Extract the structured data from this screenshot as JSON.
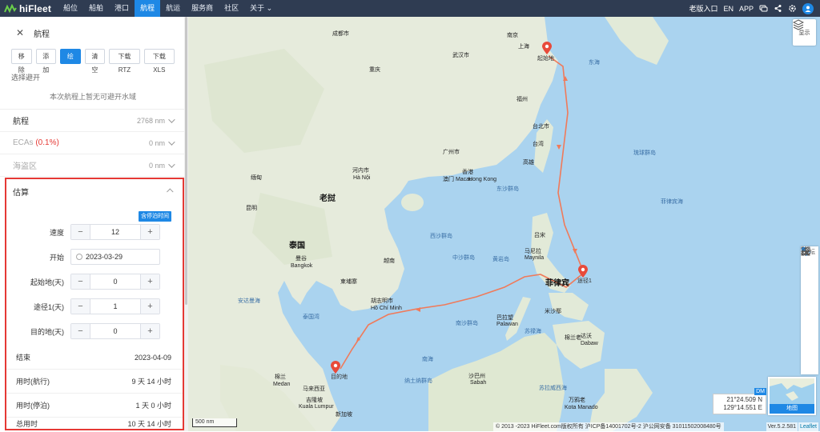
{
  "brand": {
    "name": "hiFleet"
  },
  "nav": {
    "items": [
      {
        "label": "船位",
        "active": false
      },
      {
        "label": "船舶",
        "active": false
      },
      {
        "label": "港口",
        "active": false
      },
      {
        "label": "航程",
        "active": true
      },
      {
        "label": "航运",
        "active": false
      },
      {
        "label": "服务商",
        "active": false
      },
      {
        "label": "社区",
        "active": false
      },
      {
        "label": "关于",
        "active": false
      }
    ],
    "right": {
      "old_version": "老版入口",
      "lang": "EN",
      "app": "APP"
    }
  },
  "panel": {
    "title": "航程",
    "buttons": [
      {
        "label": "移除",
        "primary": false
      },
      {
        "label": "添加",
        "primary": false
      },
      {
        "label": "绘制",
        "primary": true
      },
      {
        "label": "清空",
        "primary": false
      },
      {
        "label": "下载RTZ",
        "primary": false
      },
      {
        "label": "下载XLS",
        "primary": false
      }
    ],
    "avoid_title": "选择避开",
    "avoid_note": "本次航程上暂无可避开水域",
    "metrics": [
      {
        "label": "航程",
        "value": "2768 nm",
        "muted": false
      },
      {
        "label": "ECAs",
        "extra": "(0.1%)",
        "value": "0 nm",
        "muted": true
      },
      {
        "label": "海盗区",
        "value": "0 nm",
        "muted": true
      }
    ],
    "estimate": {
      "title": "估算",
      "stop_time_button": "含停泊时间",
      "speed": {
        "label": "速度",
        "value": "12"
      },
      "start": {
        "label": "开始",
        "value": "2023-03-29"
      },
      "origin_days": {
        "label": "起始地(天)",
        "value": "0"
      },
      "waypoint_days": {
        "label": "途径1(天)",
        "value": "1"
      },
      "dest_days": {
        "label": "目的地(天)",
        "value": "0"
      },
      "results": [
        {
          "label": "结束",
          "value": "2023-04-09"
        },
        {
          "label": "用时(航行)",
          "value": "9 天 14 小时"
        },
        {
          "label": "用时(停泊)",
          "value": "1 天 0 小时"
        },
        {
          "label": "总用时",
          "value": "10 天 14 小时"
        }
      ]
    }
  },
  "map": {
    "layers_label": "显示",
    "toolbox_label": "论坛",
    "coord_lat": "21°24.509 N",
    "coord_lon": "129°14.551 E",
    "coord_tag": "DM",
    "minimap_label": "地图",
    "scale": "500 nm",
    "attribution": "© 2013 -2023 HiFleet.com版权所有 沪ICP备14001702号-2 沪公网安备 31011502008480号",
    "version": "Ver.5.2.581",
    "leaflet": "Leaflet",
    "markers": {
      "origin": "起始地",
      "waypoint": "途径1",
      "destination": "目的地"
    },
    "labels": {
      "chengdu": "成都市",
      "chongqing": "重庆",
      "wuhan": "武汉市",
      "shanghai": "上海",
      "nanjing": "南京",
      "hangzhou": "杭州",
      "donghai": "东海",
      "fuzhou": "福州",
      "taibei": "台北市",
      "taiwan": "台湾",
      "gaoxiong": "高雄",
      "guangzhou": "广州市",
      "xianggang": "香港",
      "hongkong": "Hong Kong",
      "aomen": "澳门 Macau",
      "dongsha": "东沙群岛",
      "hanoi_cn": "河内市",
      "hanoi": "Hà Nội",
      "laos": "老挝",
      "burma": "缅甸",
      "thailand": "泰国",
      "bangkok_cn": "曼谷",
      "bangkok": "Bangkok",
      "cambodia": "柬埔寨",
      "vietnam": "越南",
      "hcm_cn": "胡志明市",
      "hcm": "Hồ Chí Minh",
      "xisha": "西沙群岛",
      "zhongsha": "中沙群岛",
      "huangyan": "黄岩岛",
      "nansha": "南沙群岛",
      "manila_cn": "马尼拉",
      "manila": "Maynila",
      "philippines": "菲律宾",
      "luzon": "吕宋",
      "feilvbinhai": "菲律宾海",
      "andaman": "安达曼海",
      "thaigulf": "泰国湾",
      "medan_cn": "棉兰",
      "medan": "Medan",
      "malaysia": "马来西亚",
      "kl_cn": "吉隆坡",
      "kl": "Kuala Lumpur",
      "singapore": "新加坡",
      "natuna": "纳土纳群岛",
      "sabah": "沙巴州",
      "sabah_en": "Sabah",
      "brunei": "文莱",
      "kotakina": "哥打基纳巴卢",
      "nanhai": "南海",
      "liuqiu": "琉球群岛",
      "palawan_cn": "巴拉望",
      "palawan": "Palawan",
      "sulu": "苏禄海",
      "mindanao": "棉兰老",
      "davao_cn": "达沃",
      "davao": "Dabaw",
      "celebes": "苏拉威西海",
      "manado": "万鸦老",
      "manado_en": "Kota Manado",
      "visayas": "米沙鄢",
      "kunming": "昆明"
    }
  }
}
